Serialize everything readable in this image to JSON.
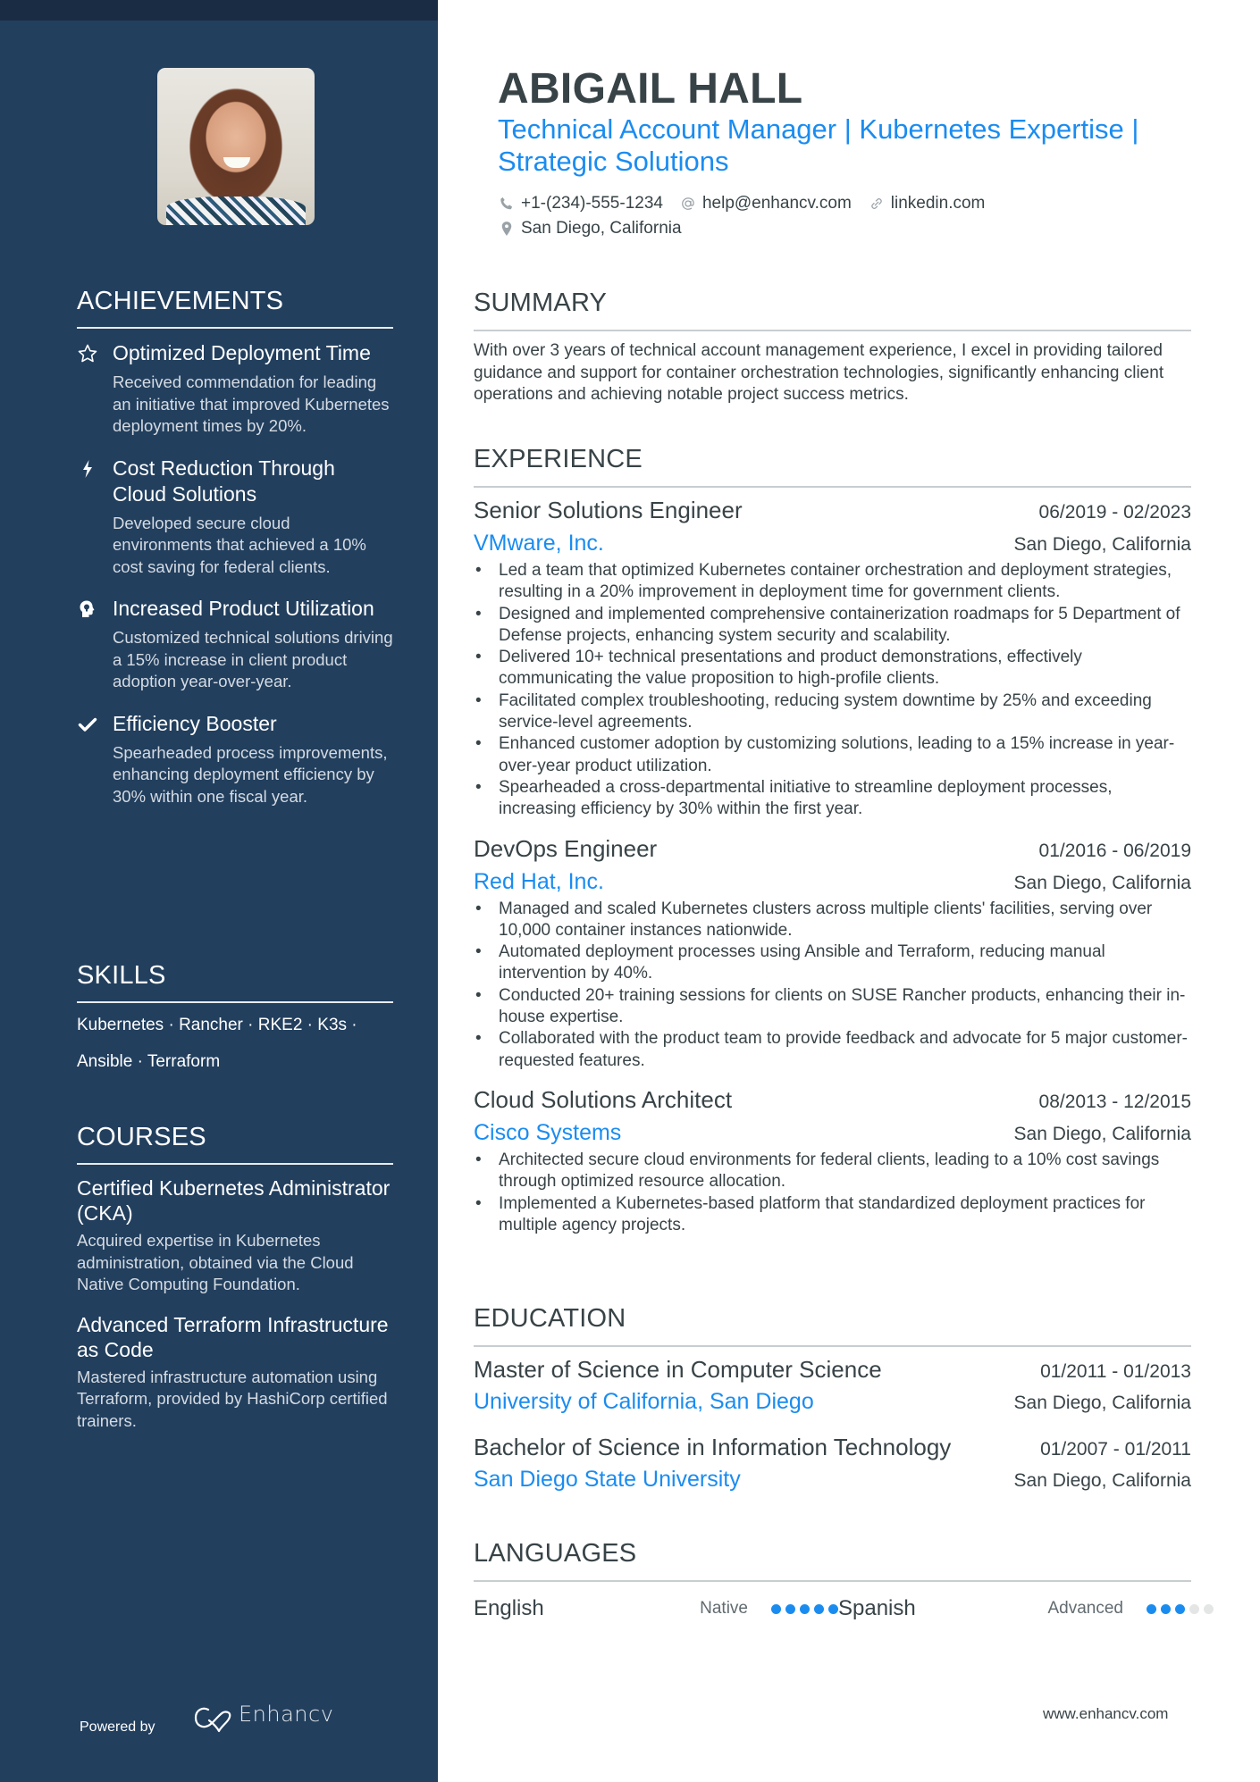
{
  "profile": {
    "name": "ABIGAIL HALL",
    "title": "Technical Account Manager | Kubernetes Expertise | Strategic Solutions",
    "phone": "+1-(234)-555-1234",
    "email": "help@enhancv.com",
    "link": "linkedin.com",
    "location": "San Diego, California"
  },
  "sidebar": {
    "achievements": {
      "heading": "ACHIEVEMENTS",
      "items": [
        {
          "icon": "star-icon",
          "title": "Optimized Deployment Time",
          "desc": "Received commendation for leading an initiative that improved Kubernetes deployment times by 20%."
        },
        {
          "icon": "lightning-icon",
          "title": "Cost Reduction Through Cloud Solutions",
          "desc": "Developed secure cloud environments that achieved a 10% cost saving for federal clients."
        },
        {
          "icon": "head-bulb-icon",
          "title": "Increased Product Utilization",
          "desc": "Customized technical solutions driving a 15% increase in client product adoption year-over-year."
        },
        {
          "icon": "checkmark-icon",
          "title": "Efficiency Booster",
          "desc": "Spearheaded process improvements, enhancing deployment efficiency by 30% within one fiscal year."
        }
      ]
    },
    "skills": {
      "heading": "SKILLS",
      "line1": "Kubernetes · Rancher · RKE2 · K3s ·",
      "line2": "Ansible · Terraform"
    },
    "courses": {
      "heading": "COURSES",
      "items": [
        {
          "title": "Certified Kubernetes Administrator (CKA)",
          "desc": "Acquired expertise in Kubernetes administration, obtained via the Cloud Native Computing Foundation."
        },
        {
          "title": "Advanced Terraform Infrastructure as Code",
          "desc": "Mastered infrastructure automation using Terraform, provided by HashiCorp certified trainers."
        }
      ]
    },
    "footer": {
      "powered_by": "Powered by",
      "brand": "Enhancv"
    }
  },
  "summary": {
    "heading": "SUMMARY",
    "text": "With over 3 years of technical account management experience, I excel in providing tailored guidance and support for container orchestration technologies, significantly enhancing client operations and achieving notable project success metrics."
  },
  "experience": {
    "heading": "EXPERIENCE",
    "jobs": [
      {
        "role": "Senior Solutions Engineer",
        "dates": "06/2019 - 02/2023",
        "company": "VMware, Inc.",
        "location": "San Diego, California",
        "bullets": [
          "Led a team that optimized Kubernetes container orchestration and deployment strategies, resulting in a 20% improvement in deployment time for government clients.",
          "Designed and implemented comprehensive containerization roadmaps for 5 Department of Defense projects, enhancing system security and scalability.",
          "Delivered 10+ technical presentations and product demonstrations, effectively communicating the value proposition to high-profile clients.",
          "Facilitated complex troubleshooting, reducing system downtime by 25% and exceeding service-level agreements.",
          "Enhanced customer adoption by customizing solutions, leading to a 15% increase in year-over-year product utilization.",
          "Spearheaded a cross-departmental initiative to streamline deployment processes, increasing efficiency by 30% within the first year."
        ]
      },
      {
        "role": "DevOps Engineer",
        "dates": "01/2016 - 06/2019",
        "company": "Red Hat, Inc.",
        "location": "San Diego, California",
        "bullets": [
          "Managed and scaled Kubernetes clusters across multiple clients' facilities, serving over 10,000 container instances nationwide.",
          "Automated deployment processes using Ansible and Terraform, reducing manual intervention by 40%.",
          "Conducted 20+ training sessions for clients on SUSE Rancher products, enhancing their in-house expertise.",
          "Collaborated with the product team to provide feedback and advocate for 5 major customer-requested features."
        ]
      },
      {
        "role": "Cloud Solutions Architect",
        "dates": "08/2013 - 12/2015",
        "company": "Cisco Systems",
        "location": "San Diego, California",
        "bullets": [
          "Architected secure cloud environments for federal clients, leading to a 10% cost savings through optimized resource allocation.",
          "Implemented a Kubernetes-based platform that standardized deployment practices for multiple agency projects."
        ]
      }
    ]
  },
  "education": {
    "heading": "EDUCATION",
    "items": [
      {
        "degree": "Master of Science in Computer Science",
        "dates": "01/2011 - 01/2013",
        "school": "University of California, San Diego",
        "location": "San Diego, California"
      },
      {
        "degree": "Bachelor of Science in Information Technology",
        "dates": "01/2007 - 01/2011",
        "school": "San Diego State University",
        "location": "San Diego, California"
      }
    ]
  },
  "languages": {
    "heading": "LANGUAGES",
    "items": [
      {
        "name": "English",
        "level": "Native",
        "rating": 5,
        "max": 5
      },
      {
        "name": "Spanish",
        "level": "Advanced",
        "rating": 3,
        "max": 5
      }
    ]
  },
  "footer": {
    "website": "www.enhancv.com"
  },
  "colors": {
    "sidebar": "#223f5e",
    "topstrip": "#1a2c43",
    "accent": "#1a8cf0",
    "text": "#384347",
    "dot_off": "#e4e6e6"
  }
}
